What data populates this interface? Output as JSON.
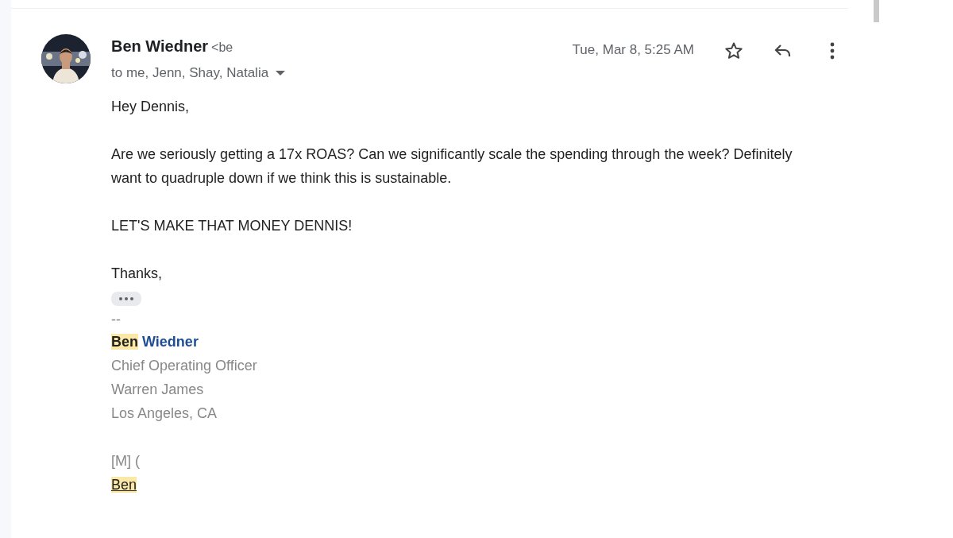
{
  "message": {
    "sender_name": "Ben Wiedner",
    "sender_address": "<be",
    "recipients": "to me, Jenn, Shay, Natalia",
    "date": "Tue, Mar 8, 5:25 AM",
    "starred": false,
    "body": [
      "Hey Dennis,",
      "Are we seriously getting a 17x ROAS? Can we significantly scale the spending through the week? Definitely want to quadruple down if we think this is sustainable.",
      "LET'S MAKE THAT MONEY DENNIS!",
      "Thanks,"
    ],
    "signature": {
      "separator": "--",
      "name_parts": [
        {
          "text": "Ben",
          "highlighted": true
        },
        {
          "text": "Wiedner",
          "highlighted": false
        }
      ],
      "lines": [
        "Chief Operating Officer",
        "Warren James",
        "Los Angeles, CA"
      ],
      "phone": "[M] (",
      "email_parts": [
        {
          "text": "Ben",
          "highlighted": true
        }
      ]
    }
  }
}
